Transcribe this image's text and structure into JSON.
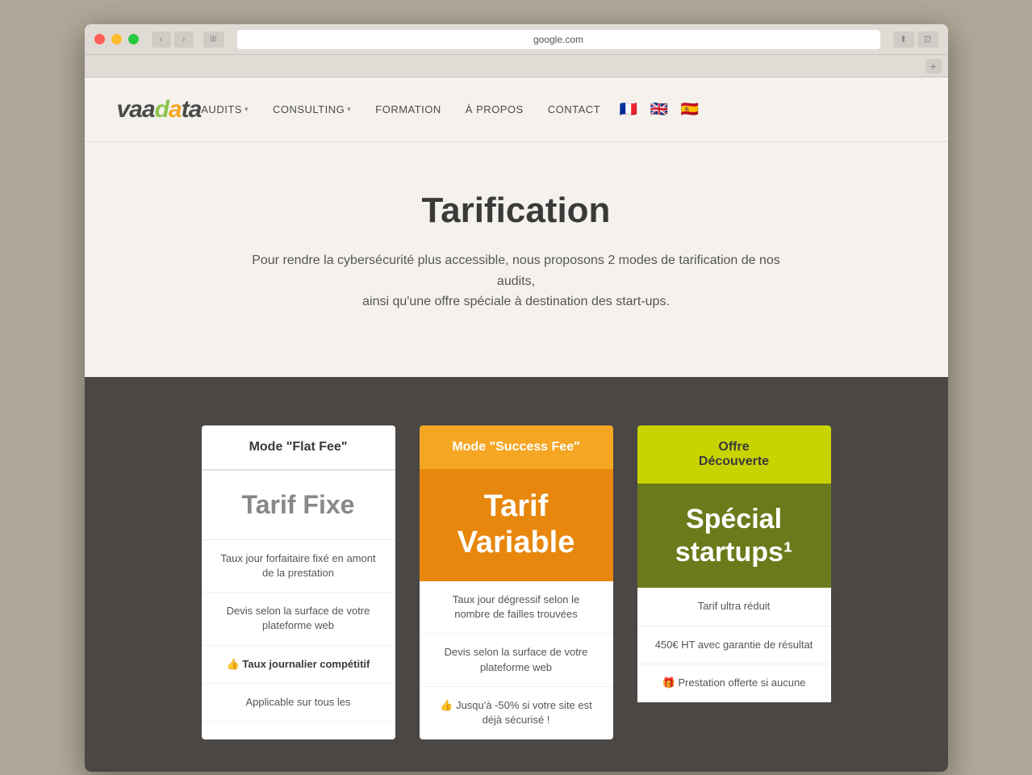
{
  "browser": {
    "url": "google.com",
    "dots": [
      "red",
      "yellow",
      "green"
    ]
  },
  "nav": {
    "logo": "vaadata",
    "links": [
      {
        "label": "AUDITS",
        "hasDropdown": true
      },
      {
        "label": "CONSULTING",
        "hasDropdown": true
      },
      {
        "label": "FORMATION",
        "hasDropdown": false
      },
      {
        "label": "À PROPOS",
        "hasDropdown": false
      },
      {
        "label": "CONTACT",
        "hasDropdown": false
      }
    ],
    "flags": [
      "🇫🇷",
      "🇬🇧",
      "🇪🇸"
    ]
  },
  "hero": {
    "title": "Tarification",
    "subtitle_line1": "Pour rendre la cybersécurité plus accessible, nous proposons 2 modes de tarification de nos audits,",
    "subtitle_line2": "ainsi qu'une offre spéciale à destination des start-ups."
  },
  "pricing": {
    "cards": [
      {
        "id": "flat-fee",
        "header": "Mode \"Flat Fee\"",
        "body_title": "Tarif Fixe",
        "features": [
          "Taux jour forfaitaire fixé en amont de la prestation",
          "Devis selon la surface de votre plateforme web",
          "👍 Taux journalier compétitif",
          "Applicable sur tous les"
        ]
      },
      {
        "id": "success-fee",
        "header": "Mode \"Success Fee\"",
        "body_title_line1": "Tarif",
        "body_title_line2": "Variable",
        "features": [
          "Taux jour dégressif selon le nombre de failles trouvées",
          "Devis selon la surface de votre plateforme web",
          "👍 Jusqu'à -50% si votre site est déjà sécurisé !"
        ]
      },
      {
        "id": "decouverte",
        "header_line1": "Offre",
        "header_line2": "Découverte",
        "body_title_line1": "Spécial",
        "body_title_line2": "startups¹",
        "features": [
          "Tarif ultra réduit",
          "450€ HT avec garantie de résultat",
          "🎁 Prestation offerte si aucune"
        ]
      }
    ]
  }
}
